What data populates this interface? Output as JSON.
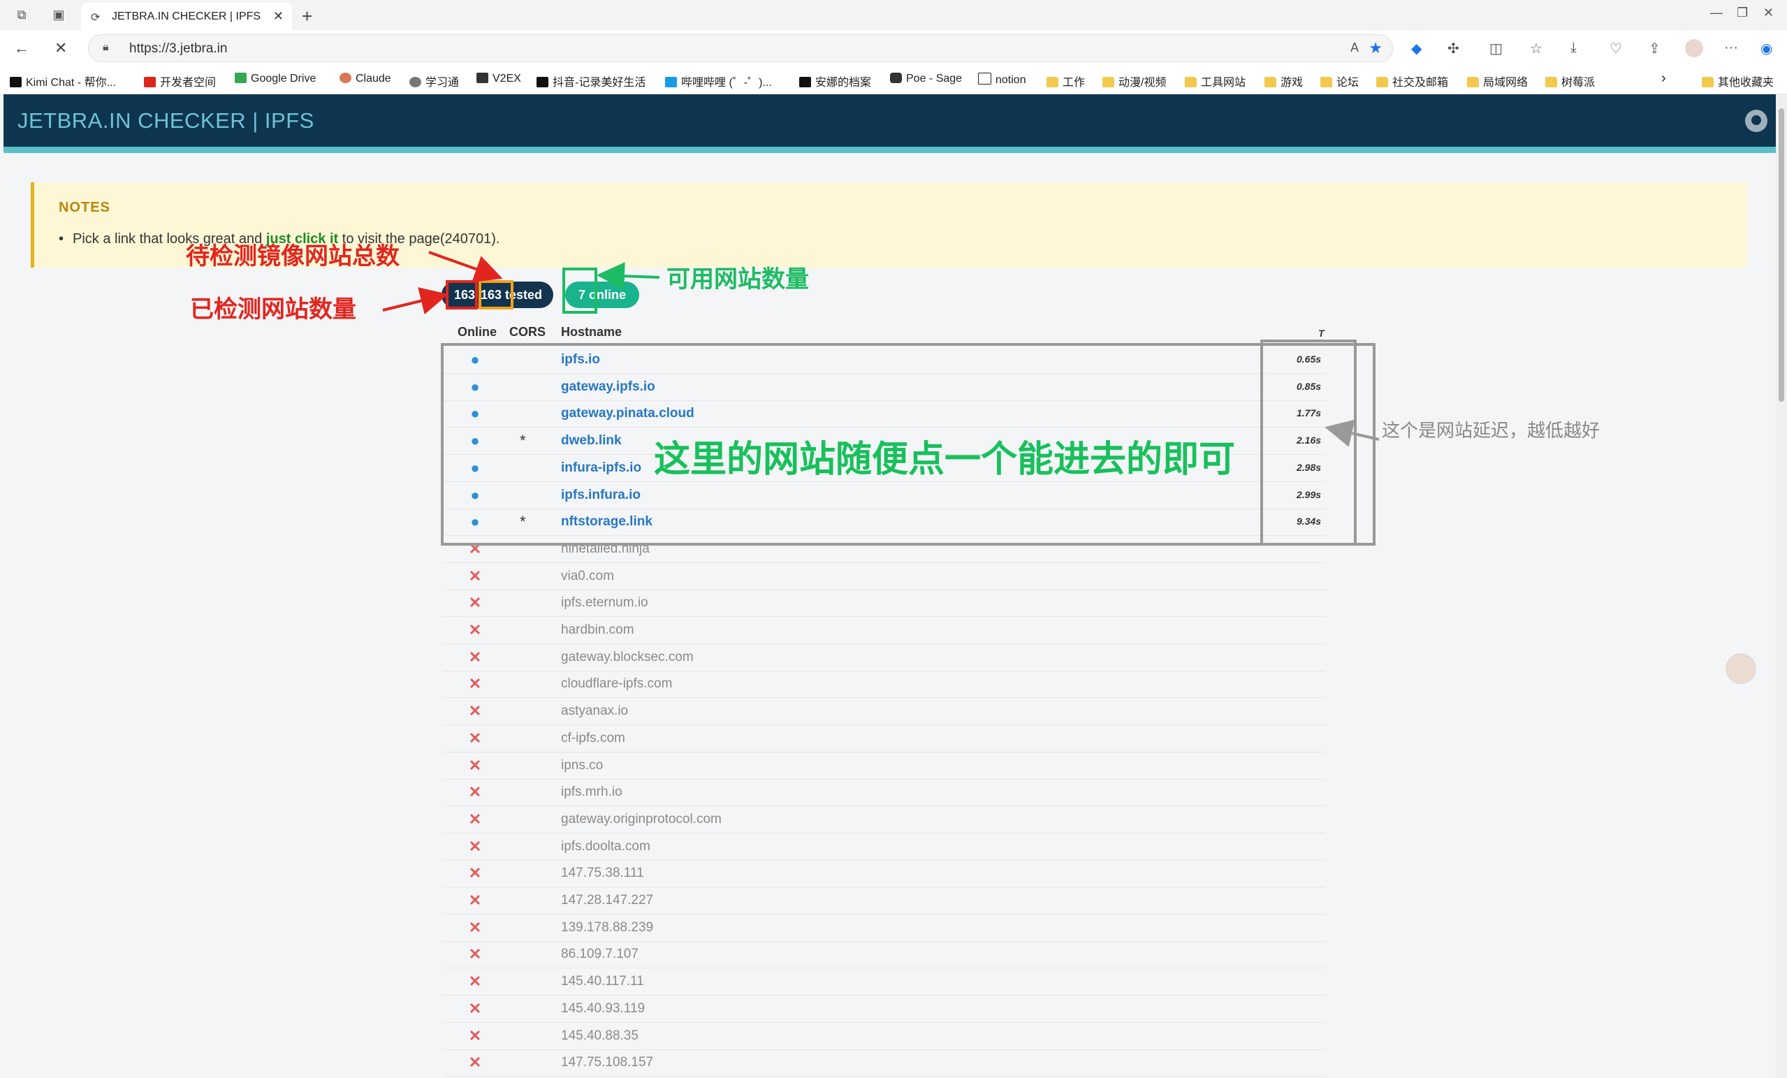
{
  "browser": {
    "tab_title": "JETBRA.IN CHECKER | IPFS",
    "url": "https://3.jetbra.in",
    "bookmarks": [
      "Kimi Chat - 帮你...",
      "开发者空间",
      "Google Drive",
      "Claude",
      "学习通",
      "V2EX",
      "抖音-记录美好生活",
      "哔哩哔哩 (゜-゜)...",
      "安娜的档案",
      "Poe - Sage",
      "notion",
      "工作",
      "动漫/视频",
      "工具网站",
      "游戏",
      "论坛",
      "社交及邮箱",
      "局域网络",
      "树莓派"
    ],
    "other_bookmarks": "其他收藏夹",
    "colors": {
      "star": "#1a73e8"
    }
  },
  "site": {
    "title": "JETBRA.IN CHECKER | IPFS",
    "notes_title": "NOTES",
    "notes_pre": "Pick a link that looks great and ",
    "notes_link": "just click it",
    "notes_post": " to visit the page(240701).",
    "total": "163",
    "tested": "163 tested",
    "online": "7 online",
    "headers": {
      "online": "Online",
      "cors": "CORS",
      "hostname": "Hostname",
      "time": "T"
    },
    "colors": {
      "header_bg": "#0d3550",
      "accent": "#5bc0c8",
      "badge_green": "#19b38d"
    }
  },
  "rows": [
    {
      "online": true,
      "cors": "",
      "host": "ipfs.io",
      "time": "0.65s"
    },
    {
      "online": true,
      "cors": "",
      "host": "gateway.ipfs.io",
      "time": "0.85s"
    },
    {
      "online": true,
      "cors": "",
      "host": "gateway.pinata.cloud",
      "time": "1.77s"
    },
    {
      "online": true,
      "cors": "*",
      "host": "dweb.link",
      "time": "2.16s"
    },
    {
      "online": true,
      "cors": "",
      "host": "infura-ipfs.io",
      "time": "2.98s"
    },
    {
      "online": true,
      "cors": "",
      "host": "ipfs.infura.io",
      "time": "2.99s"
    },
    {
      "online": true,
      "cors": "*",
      "host": "nftstorage.link",
      "time": "9.34s"
    },
    {
      "online": false,
      "cors": "",
      "host": "ninetailed.ninja",
      "time": ""
    },
    {
      "online": false,
      "cors": "",
      "host": "via0.com",
      "time": ""
    },
    {
      "online": false,
      "cors": "",
      "host": "ipfs.eternum.io",
      "time": ""
    },
    {
      "online": false,
      "cors": "",
      "host": "hardbin.com",
      "time": ""
    },
    {
      "online": false,
      "cors": "",
      "host": "gateway.blocksec.com",
      "time": ""
    },
    {
      "online": false,
      "cors": "",
      "host": "cloudflare-ipfs.com",
      "time": ""
    },
    {
      "online": false,
      "cors": "",
      "host": "astyanax.io",
      "time": ""
    },
    {
      "online": false,
      "cors": "",
      "host": "cf-ipfs.com",
      "time": ""
    },
    {
      "online": false,
      "cors": "",
      "host": "ipns.co",
      "time": ""
    },
    {
      "online": false,
      "cors": "",
      "host": "ipfs.mrh.io",
      "time": ""
    },
    {
      "online": false,
      "cors": "",
      "host": "gateway.originprotocol.com",
      "time": ""
    },
    {
      "online": false,
      "cors": "",
      "host": "ipfs.doolta.com",
      "time": ""
    },
    {
      "online": false,
      "cors": "",
      "host": "147.75.38.111",
      "time": ""
    },
    {
      "online": false,
      "cors": "",
      "host": "147.28.147.227",
      "time": ""
    },
    {
      "online": false,
      "cors": "",
      "host": "139.178.88.239",
      "time": ""
    },
    {
      "online": false,
      "cors": "",
      "host": "86.109.7.107",
      "time": ""
    },
    {
      "online": false,
      "cors": "",
      "host": "145.40.117.11",
      "time": ""
    },
    {
      "online": false,
      "cors": "",
      "host": "145.40.93.119",
      "time": ""
    },
    {
      "online": false,
      "cors": "",
      "host": "145.40.88.35",
      "time": ""
    },
    {
      "online": false,
      "cors": "",
      "host": "147.75.108.157",
      "time": ""
    }
  ],
  "annotations": {
    "total_label": "待检测镜像网站总数",
    "tested_label": "已检测网站数量",
    "online_label": "可用网站数量",
    "pick_label": "这里的网站随便点一个能进去的即可",
    "latency_label": "这个是网站延迟，越低越好",
    "colors": {
      "red": "#e2261f",
      "green": "#1dbb63",
      "orange": "#f2a21b",
      "gray": "#888888"
    }
  }
}
